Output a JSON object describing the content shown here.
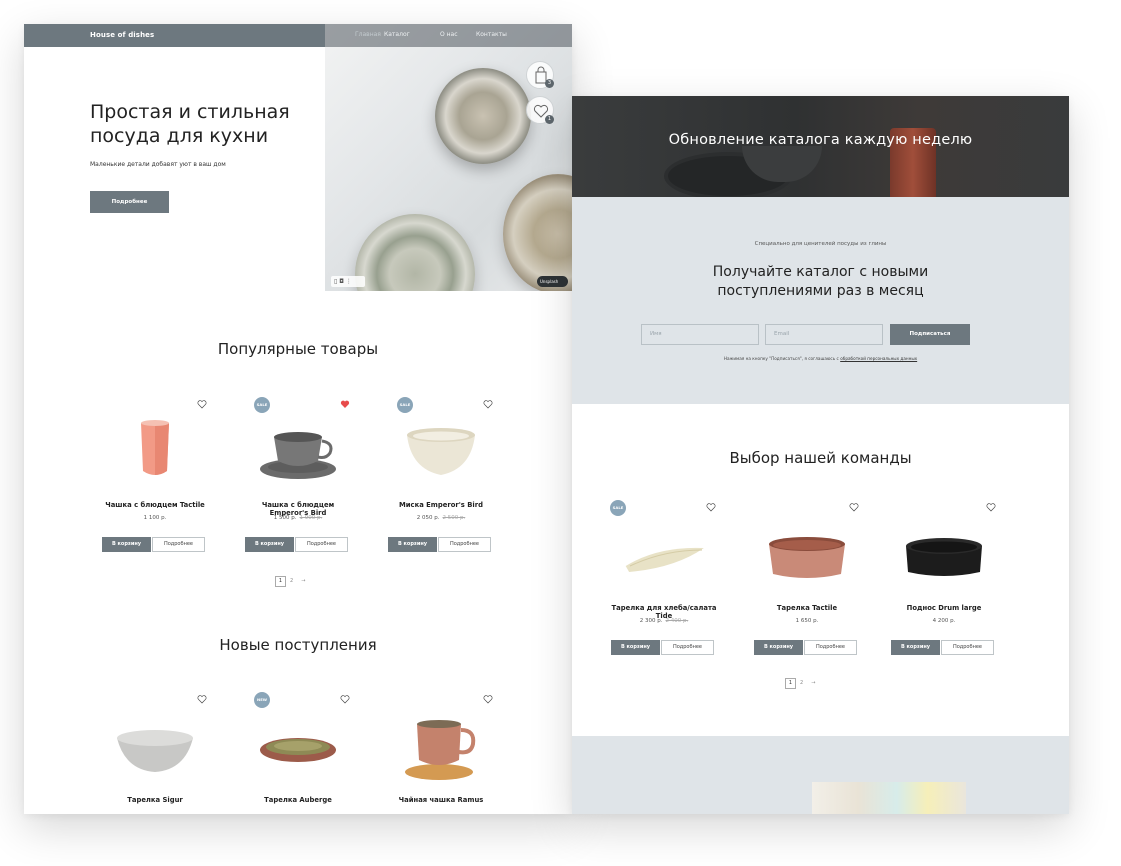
{
  "page1": {
    "brand": "House of dishes",
    "nav": [
      "Главная",
      "Каталог",
      "О нас",
      "Контакты"
    ],
    "hero": {
      "title": "Простая и стильная посуда для кухни",
      "subtitle": "Маленькие детали добавят уют в ваш дом",
      "button": "Подробнее",
      "cart_count": "3",
      "fav_count": "1",
      "photo_credit": "Unsplash"
    },
    "popular": {
      "title": "Популярные товары",
      "items": [
        {
          "name": "Чашка с блюдцем Tactile",
          "price": "1 100 р.",
          "old_price": "",
          "badge": "",
          "fav": false
        },
        {
          "name": "Чашка с блюдцем Emperor's Bird",
          "price": "1 500 р.",
          "old_price": "1 900 р.",
          "badge": "SALE",
          "fav": true
        },
        {
          "name": "Миска Emperor's Bird",
          "price": "2 050 р.",
          "old_price": "2 500 р.",
          "badge": "SALE",
          "fav": false
        }
      ],
      "cart_label": "В корзину",
      "more_label": "Подробнее",
      "pages": [
        "1",
        "2",
        "→"
      ]
    },
    "new_arrivals": {
      "title": "Новые поступления",
      "items": [
        {
          "name": "Тарелка Sigur",
          "badge": ""
        },
        {
          "name": "Тарелка Auberge",
          "badge": "NEW"
        },
        {
          "name": "Чайная чашка Ramus",
          "badge": ""
        }
      ]
    }
  },
  "page2": {
    "banner_title": "Обновление каталога каждую неделю",
    "subscribe": {
      "small": "Специально для ценителей посуды из глины",
      "title_line1": "Получайте каталог с новыми",
      "title_line2": "поступлениями раз в месяц",
      "name_placeholder": "Имя",
      "email_placeholder": "Email",
      "button": "Подписаться",
      "agree_text": "Нажимая на кнопку \"Подписаться\", я соглашаюсь с",
      "agree_link": "обработкой персональных данных"
    },
    "team": {
      "title": "Выбор нашей команды",
      "items": [
        {
          "name": "Тарелка для хлеба/салата Tide",
          "price": "2 300 р.",
          "old_price": "2 400 р.",
          "badge": "SALE"
        },
        {
          "name": "Тарелка Tactile",
          "price": "1 650 р.",
          "old_price": "",
          "badge": ""
        },
        {
          "name": "Поднос Drum large",
          "price": "4 200 р.",
          "old_price": "",
          "badge": ""
        }
      ],
      "cart_label": "В корзину",
      "more_label": "Подробнее",
      "pages": [
        "1",
        "2",
        "→"
      ]
    }
  },
  "colors": {
    "primary": "#6d787f",
    "badge": "#8aa5b8",
    "light_bg": "#dfe4e8",
    "fav_active": "#e84b4b"
  }
}
